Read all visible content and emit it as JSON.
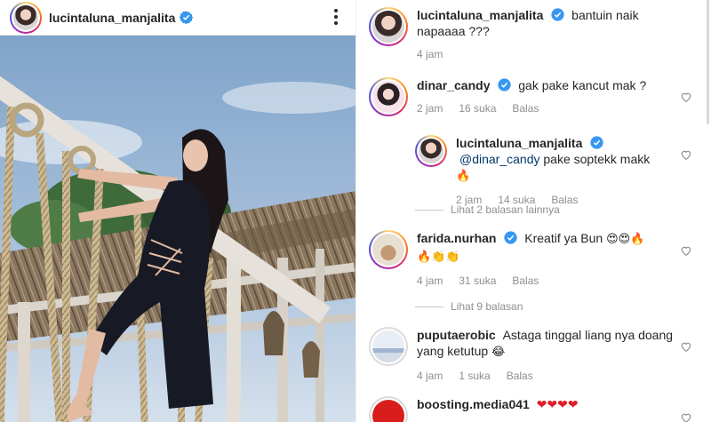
{
  "post": {
    "username": "lucintaluna_manjalita",
    "verified": true,
    "more_icon": "more-vertical-icon"
  },
  "caption": {
    "username": "lucintaluna_manjalita",
    "text": "bantuin naik napaaaa ???",
    "time": "4 jam"
  },
  "comments": [
    {
      "username": "dinar_candy",
      "verified": true,
      "text": "gak pake kancut mak ?",
      "time": "2 jam",
      "likes": "16 suka",
      "reply_label": "Balas"
    },
    {
      "username": "lucintaluna_manjalita",
      "verified": true,
      "mention": "@dinar_candy",
      "text": " pake soptekk makk",
      "emoji": "🔥",
      "time": "2 jam",
      "likes": "14 suka",
      "reply_label": "Balas"
    },
    {
      "username": "farida.nurhan",
      "verified": true,
      "text": "Kreatif ya Bun",
      "emoji": "😍😍🔥🔥👏👏",
      "time": "4 jam",
      "likes": "31 suka",
      "reply_label": "Balas"
    },
    {
      "username": "puputaerobic",
      "verified": false,
      "text": "Astaga tinggal liang nya doang yang ketutup",
      "emoji": "😂",
      "time": "4 jam",
      "likes": "1 suka",
      "reply_label": "Balas"
    },
    {
      "username": "boosting.media041",
      "verified": false,
      "text": "",
      "emoji": "❤❤❤❤"
    }
  ],
  "view_more_replies": [
    "Lihat 2 balasan lainnya",
    "Lihat 9 balasan"
  ],
  "colors": {
    "verified_blue": "#3897f0",
    "meta_gray": "#8e8e8e",
    "text": "#262626"
  }
}
